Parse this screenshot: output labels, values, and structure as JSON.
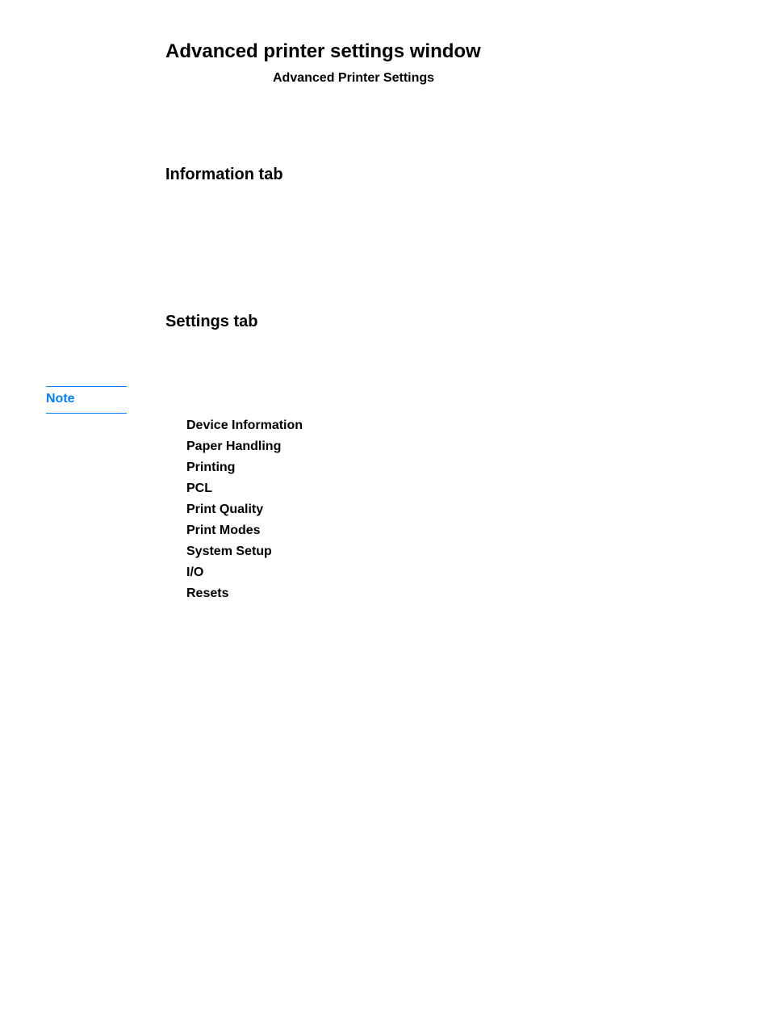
{
  "heading": "Advanced printer settings window",
  "subtitle": "Advanced Printer Settings",
  "section_info": "Information tab",
  "section_settings": "Settings tab",
  "note_label": "Note",
  "settings_items": [
    "Device Information",
    "Paper Handling",
    "Printing",
    "PCL",
    "Print Quality",
    "Print Modes",
    "System Setup",
    "I/O",
    "Resets"
  ]
}
